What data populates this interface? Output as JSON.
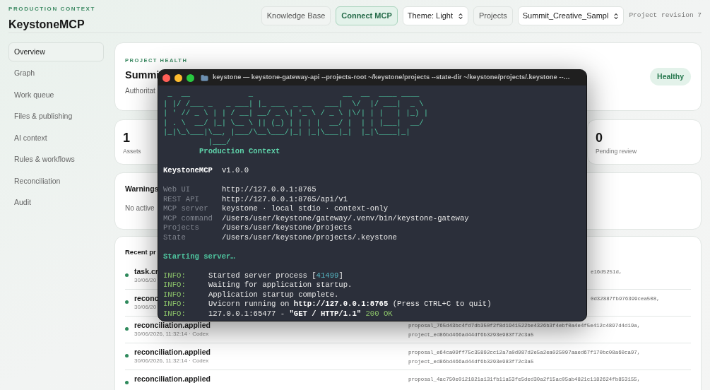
{
  "header": {
    "eyebrow": "PRODUCTION CONTEXT",
    "title": "KeystoneMCP"
  },
  "toolbar": [
    {
      "kind": "button",
      "label": "Knowledge Base"
    },
    {
      "kind": "primary",
      "label": "Connect MCP"
    },
    {
      "kind": "select",
      "label": "Theme: Light"
    },
    {
      "kind": "button",
      "label": "Projects"
    },
    {
      "kind": "select",
      "label": "Summit_Creative_Sampl"
    },
    {
      "kind": "note",
      "label": "Project revision 7"
    }
  ],
  "sidebar": {
    "items": [
      {
        "label": "Overview",
        "selected": true
      },
      {
        "label": "Graph",
        "selected": false
      },
      {
        "label": "Work queue",
        "selected": false
      },
      {
        "label": "Files & publishing",
        "selected": false
      },
      {
        "label": "AI context",
        "selected": false
      },
      {
        "label": "Rules & workflows",
        "selected": false
      },
      {
        "label": "Reconciliation",
        "selected": false
      },
      {
        "label": "Audit",
        "selected": false
      }
    ]
  },
  "health": {
    "eyebrow": "PROJECT HEALTH",
    "title": "Summi",
    "subtitle": "Authoritat",
    "badge": "Healthy"
  },
  "metrics": [
    {
      "value": "1",
      "label": "Assets"
    },
    {
      "value": "0",
      "label": "Pending review"
    }
  ],
  "warnings": {
    "title": "Warnings",
    "text": "No active"
  },
  "recent": {
    "title": "Recent pr",
    "rows": [
      {
        "kind": "partial",
        "title": "task.cr",
        "meta": "30/06/20",
        "detail": [
          "e16d5251d,"
        ]
      },
      {
        "kind": "partial",
        "title": "reconc",
        "meta": "30/06/20",
        "detail": [
          "0d32887fb976399cea508,"
        ]
      },
      {
        "kind": "full",
        "title": "reconciliation.applied",
        "meta": "30/06/2026, 11:32:14 · Codex",
        "detail": [
          "proposal_765d43bc4fd7db350f2f8d1941522be4326b3f4ebf0a4e4f5e412c4897d4d19a,",
          "project_ed86bd466ad44df6b3293e983f72c3a5"
        ]
      },
      {
        "kind": "full",
        "title": "reconciliation.applied",
        "meta": "30/06/2026, 11:32:14 · Codex",
        "detail": [
          "proposal_e64ca09ff75c35892cc12a7a0d987d2e5a2ea025097aaed67f170bc08a60ca97,",
          "project_ed86bd466ad44df6b3293e983f72c3a5"
        ]
      },
      {
        "kind": "full",
        "title": "reconciliation.applied",
        "detail": [
          "proposal_4ac750e0121821a131fb11a53fe5ded30a2f15ac05ab4821c1182624fb853155,"
        ]
      }
    ]
  },
  "terminal": {
    "title": "keystone — keystone-gateway-api --projects-root ~/keystone/projects --state-dir ~/keystone/projects/.keystone --…",
    "banner": [
      " _  __             _                    __  __  ____ ____",
      "| |/ /___ _   _ ___| |_ ___  _ __   ___|  \\/  |/ ___|  _ \\",
      "| ' // _ \\ | | / __| __/ _ \\| '_ \\ / _ \\ |\\/| | |   | |_) |",
      "| . \\  __/ |_| \\__ \\ || (_) | | | |  __/ |  | | |___|  __/",
      "|_|\\_\\___|\\__, |___/\\__\\___/|_| |_|\\___|_|  |_|\\____|_|",
      "          |___/"
    ],
    "tagline": "Production Context",
    "app": {
      "name": "KeystoneMCP",
      "version": "v1.0.0"
    },
    "info": [
      {
        "key": "Web UI",
        "value": "http://127.0.0.1:8765"
      },
      {
        "key": "REST API",
        "value": "http://127.0.0.1:8765/api/v1"
      },
      {
        "key": "MCP server",
        "value": "keystone · local stdio · context-only"
      },
      {
        "key": "MCP command",
        "value": "/Users/user/keystone/gateway/.venv/bin/keystone-gateway"
      },
      {
        "key": "Projects",
        "value": "/Users/user/keystone/projects"
      },
      {
        "key": "State",
        "value": "/Users/user/keystone/projects/.keystone"
      }
    ],
    "status": "Starting server…",
    "log": [
      {
        "level": "INFO:",
        "parts": [
          {
            "kind": "plain",
            "text": "Started server process ["
          },
          {
            "kind": "number",
            "text": "41499"
          },
          {
            "kind": "plain",
            "text": "]"
          }
        ]
      },
      {
        "level": "INFO:",
        "parts": [
          {
            "kind": "plain",
            "text": "Waiting for application startup."
          }
        ]
      },
      {
        "level": "INFO:",
        "parts": [
          {
            "kind": "plain",
            "text": "Application startup complete."
          }
        ]
      },
      {
        "level": "INFO:",
        "parts": [
          {
            "kind": "plain",
            "text": "Uvicorn running on "
          },
          {
            "kind": "bold",
            "text": "http://127.0.0.1:8765"
          },
          {
            "kind": "plain",
            "text": " (Press CTRL+C to quit)"
          }
        ]
      },
      {
        "level": "INFO:",
        "parts": [
          {
            "kind": "plain",
            "text": "127.0.0.1:65477 - "
          },
          {
            "kind": "bold",
            "text": "\"GET / HTTP/1.1\""
          },
          {
            "kind": "ok",
            "text": " 200 OK"
          }
        ]
      }
    ]
  }
}
